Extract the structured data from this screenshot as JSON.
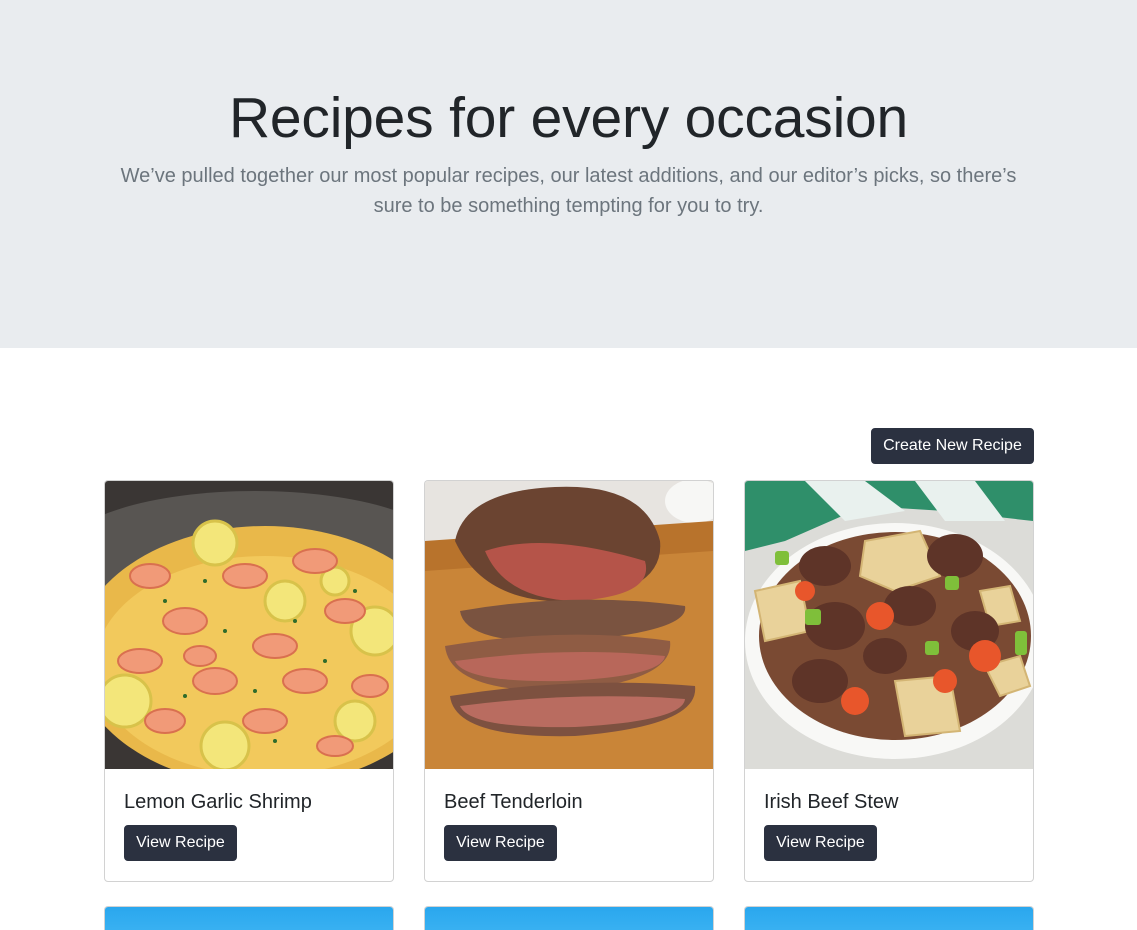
{
  "hero": {
    "title": "Recipes for every occasion",
    "lead": "We’ve pulled together our most popular recipes, our latest additions, and our editor’s picks, so there’s sure to be something tempting for you to try."
  },
  "toolbar": {
    "create_label": "Create New Recipe"
  },
  "recipes": [
    {
      "title": "Lemon Garlic Shrimp",
      "button": "View Recipe"
    },
    {
      "title": "Beef Tenderloin",
      "button": "View Recipe"
    },
    {
      "title": "Irish Beef Stew",
      "button": "View Recipe"
    }
  ],
  "colors": {
    "hero_bg": "#e9ecef",
    "button_bg": "#2b3140",
    "lead_text": "#6c757d"
  }
}
